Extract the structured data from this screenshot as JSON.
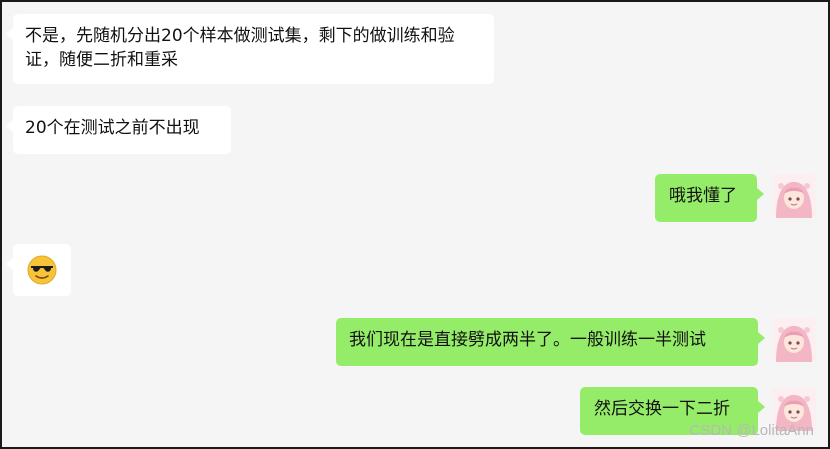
{
  "messages": [
    {
      "side": "in",
      "text": "不是，先随机分出20个样本做测试集，剩下的做训练和验证，随便二折和重采"
    },
    {
      "side": "in",
      "text": "20个在测试之前不出现"
    },
    {
      "side": "out",
      "text": "哦我懂了"
    },
    {
      "side": "in",
      "emoji": "smiling-face-with-sunglasses"
    },
    {
      "side": "out",
      "text": "我们现在是直接劈成两半了。一般训练一半测试"
    },
    {
      "side": "out",
      "text": "然后交换一下二折"
    }
  ],
  "watermark": "CSDN @LolitaAnn",
  "colors": {
    "outgoing_bubble": "#95ec69",
    "incoming_bubble": "#ffffff",
    "background": "#f5f5f5"
  }
}
